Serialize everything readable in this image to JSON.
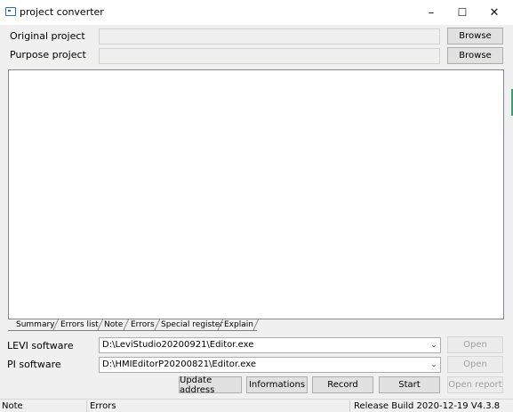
{
  "window": {
    "title": "project converter",
    "minimize_glyph": "–",
    "maximize_glyph": "☐",
    "close_glyph": "✕",
    "icon": "app-window-icon"
  },
  "paths": {
    "original_label": "Original project",
    "original_value": "",
    "purpose_label": "Purpose project",
    "purpose_value": "",
    "browse_label": "Browse"
  },
  "log": {
    "content": ""
  },
  "tabs": [
    "Summary",
    "Errors list",
    "Note",
    "Errors",
    "Special register",
    "Explain"
  ],
  "software": {
    "levi_label": "LEVI software",
    "levi_value": "D:\\LeviStudio20200921\\Editor.exe",
    "pi_label": "PI software",
    "pi_value": "D:\\HMIEditorP20200821\\Editor.exe",
    "open_label": "Open"
  },
  "actions": {
    "update_address": "Update address",
    "informations": "Informations",
    "record": "Record",
    "start": "Start",
    "open_report": "Open report"
  },
  "status": {
    "note": "Note",
    "errors": "Errors",
    "build": "Release Build 2020-12-19 V4.3.8"
  },
  "colors": {
    "window_bg": "#f0f0f0",
    "button_bg": "#e1e1e1",
    "accent_strip": "#36a076"
  }
}
